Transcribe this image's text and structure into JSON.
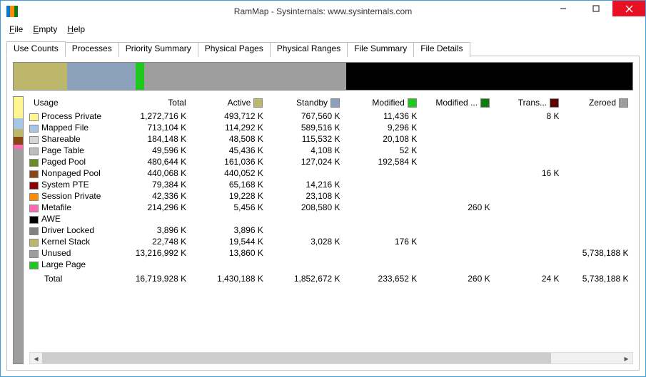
{
  "window": {
    "title": "RamMap - Sysinternals: www.sysinternals.com"
  },
  "menu": {
    "file": "File",
    "empty": "Empty",
    "help": "Help"
  },
  "tabs": [
    {
      "id": "use-counts",
      "label": "Use Counts",
      "active": true
    },
    {
      "id": "processes",
      "label": "Processes",
      "active": false
    },
    {
      "id": "priority-summary",
      "label": "Priority Summary",
      "active": false
    },
    {
      "id": "physical-pages",
      "label": "Physical Pages",
      "active": false
    },
    {
      "id": "physical-ranges",
      "label": "Physical Ranges",
      "active": false
    },
    {
      "id": "file-summary",
      "label": "File Summary",
      "active": false
    },
    {
      "id": "file-details",
      "label": "File Details",
      "active": false
    }
  ],
  "chart_data": {
    "type": "bar",
    "title": "Physical Memory by State",
    "segments": [
      {
        "name": "Active",
        "value_k": 1430188,
        "color": "#bdb76b",
        "pct": 8.6
      },
      {
        "name": "Standby",
        "value_k": 1852672,
        "color": "#8ca2bc",
        "pct": 11.1
      },
      {
        "name": "Modified",
        "value_k": 233652,
        "color": "#1ec81e",
        "pct": 1.4
      },
      {
        "name": "Unused",
        "value_k": 13216992,
        "color": "#9e9e9e",
        "pct": 32.6
      },
      {
        "name": "Zeroed",
        "value_k": 5738188,
        "color": "#000000",
        "pct": 46.3
      }
    ],
    "total_k": 16719928
  },
  "vbar": [
    {
      "color": "#fff68f",
      "pct": 8
    },
    {
      "color": "#a7c6e6",
      "pct": 4
    },
    {
      "color": "#bdb76b",
      "pct": 3
    },
    {
      "color": "#8b4513",
      "pct": 3
    },
    {
      "color": "#ff69b4",
      "pct": 1.5
    },
    {
      "color": "#9e9e9e",
      "pct": 80.5
    }
  ],
  "columns": {
    "usage": "Usage",
    "total": "Total",
    "active": {
      "label": "Active",
      "color": "#bdb76b"
    },
    "standby": {
      "label": "Standby",
      "color": "#8ca2bc"
    },
    "modified": {
      "label": "Modified",
      "color": "#1ec81e"
    },
    "modified_nowrite": {
      "label": "Modified ...",
      "color": "#107c10"
    },
    "transition": {
      "label": "Trans...",
      "color": "#5a0000"
    },
    "zeroed": {
      "label": "Zeroed",
      "color": "#9e9e9e"
    }
  },
  "rows": [
    {
      "color": "#fff68f",
      "name": "Process Private",
      "total": "1,272,716 K",
      "active": "493,712 K",
      "standby": "767,560 K",
      "modified": "11,436 K",
      "modnw": "",
      "trans": "8 K",
      "zeroed": ""
    },
    {
      "color": "#a7c6e6",
      "name": "Mapped File",
      "total": "713,104 K",
      "active": "114,292 K",
      "standby": "589,516 K",
      "modified": "9,296 K",
      "modnw": "",
      "trans": "",
      "zeroed": ""
    },
    {
      "color": "#d6d6d6",
      "name": "Shareable",
      "total": "184,148 K",
      "active": "48,508 K",
      "standby": "115,532 K",
      "modified": "20,108 K",
      "modnw": "",
      "trans": "",
      "zeroed": ""
    },
    {
      "color": "#bdbdbd",
      "name": "Page Table",
      "total": "49,596 K",
      "active": "45,436 K",
      "standby": "4,108 K",
      "modified": "52 K",
      "modnw": "",
      "trans": "",
      "zeroed": ""
    },
    {
      "color": "#6b8e23",
      "name": "Paged Pool",
      "total": "480,644 K",
      "active": "161,036 K",
      "standby": "127,024 K",
      "modified": "192,584 K",
      "modnw": "",
      "trans": "",
      "zeroed": ""
    },
    {
      "color": "#8b4513",
      "name": "Nonpaged Pool",
      "total": "440,068 K",
      "active": "440,052 K",
      "standby": "",
      "modified": "",
      "modnw": "",
      "trans": "16 K",
      "zeroed": ""
    },
    {
      "color": "#8b0000",
      "name": "System PTE",
      "total": "79,384 K",
      "active": "65,168 K",
      "standby": "14,216 K",
      "modified": "",
      "modnw": "",
      "trans": "",
      "zeroed": ""
    },
    {
      "color": "#ff8c00",
      "name": "Session Private",
      "total": "42,336 K",
      "active": "19,228 K",
      "standby": "23,108 K",
      "modified": "",
      "modnw": "",
      "trans": "",
      "zeroed": ""
    },
    {
      "color": "#ff69b4",
      "name": "Metafile",
      "total": "214,296 K",
      "active": "5,456 K",
      "standby": "208,580 K",
      "modified": "",
      "modnw": "260 K",
      "trans": "",
      "zeroed": ""
    },
    {
      "color": "#000000",
      "name": "AWE",
      "total": "",
      "active": "",
      "standby": "",
      "modified": "",
      "modnw": "",
      "trans": "",
      "zeroed": ""
    },
    {
      "color": "#808080",
      "name": "Driver Locked",
      "total": "3,896 K",
      "active": "3,896 K",
      "standby": "",
      "modified": "",
      "modnw": "",
      "trans": "",
      "zeroed": ""
    },
    {
      "color": "#bdb76b",
      "name": "Kernel Stack",
      "total": "22,748 K",
      "active": "19,544 K",
      "standby": "3,028 K",
      "modified": "176 K",
      "modnw": "",
      "trans": "",
      "zeroed": ""
    },
    {
      "color": "#9e9e9e",
      "name": "Unused",
      "total": "13,216,992 K",
      "active": "13,860 K",
      "standby": "",
      "modified": "",
      "modnw": "",
      "trans": "",
      "zeroed": "5,738,188 K"
    },
    {
      "color": "#1ec81e",
      "name": "Large Page",
      "total": "",
      "active": "",
      "standby": "",
      "modified": "",
      "modnw": "",
      "trans": "",
      "zeroed": ""
    }
  ],
  "totals": {
    "label": "Total",
    "total": "16,719,928 K",
    "active": "1,430,188 K",
    "standby": "1,852,672 K",
    "modified": "233,652 K",
    "modnw": "260 K",
    "trans": "24 K",
    "zeroed": "5,738,188 K"
  }
}
